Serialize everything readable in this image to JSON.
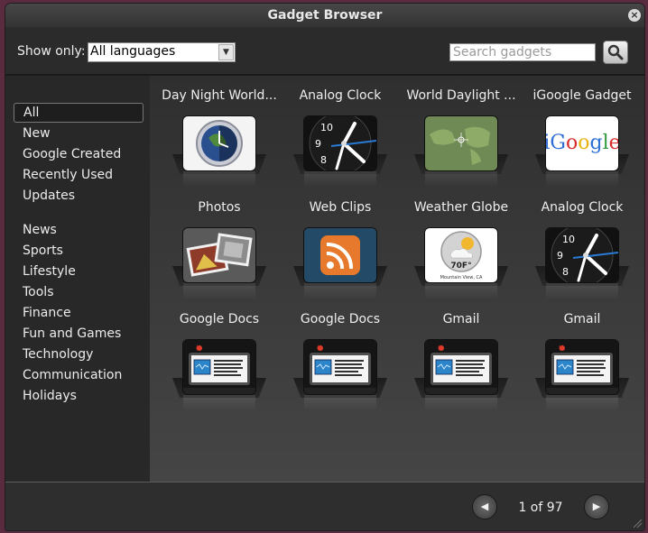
{
  "window": {
    "title": "Gadget Browser",
    "close_glyph": "×"
  },
  "toolbar": {
    "show_only_label": "Show only:",
    "language_selected": "All languages",
    "search_placeholder": "Search gadgets",
    "search_icon": "magnifier-icon"
  },
  "sidebar": {
    "categories": [
      "All",
      "New",
      "Google Created",
      "Recently Used",
      "Updates",
      "News",
      "Sports",
      "Lifestyle",
      "Tools",
      "Finance",
      "Fun and Games",
      "Technology",
      "Communication",
      "Holidays"
    ],
    "selected": "All"
  },
  "gadgets": [
    {
      "name": "Day Night World...",
      "icon": "globe-clock-icon"
    },
    {
      "name": "Analog Clock",
      "icon": "analog-clock-icon"
    },
    {
      "name": "World Daylight ...",
      "icon": "world-map-icon"
    },
    {
      "name": "iGoogle Gadget",
      "icon": "igoogle-logo-icon"
    },
    {
      "name": "Photos",
      "icon": "photos-icon"
    },
    {
      "name": "Web Clips",
      "icon": "rss-feed-icon"
    },
    {
      "name": "Weather Globe",
      "icon": "weather-globe-icon",
      "thumb_text": "70F°",
      "thumb_caption": "Mountain View, CA"
    },
    {
      "name": "Analog Clock",
      "icon": "analog-clock-icon"
    },
    {
      "name": "Google Docs",
      "icon": "docs-widget-icon"
    },
    {
      "name": "Google Docs",
      "icon": "docs-widget-icon"
    },
    {
      "name": "Gmail",
      "icon": "gmail-widget-icon"
    },
    {
      "name": "Gmail",
      "icon": "gmail-widget-icon"
    }
  ],
  "clock_labels": {
    "ten": "10",
    "nine": "9",
    "eight": "8"
  },
  "pagination": {
    "prev_glyph": "◀",
    "next_glyph": "▶",
    "current_label": "1 of 97"
  },
  "colors": {
    "window_bg": "#3c3c3c",
    "sidebar_bg": "#282828",
    "clock_accent": "#2a7bd5",
    "rss_orange": "#e6792b"
  }
}
